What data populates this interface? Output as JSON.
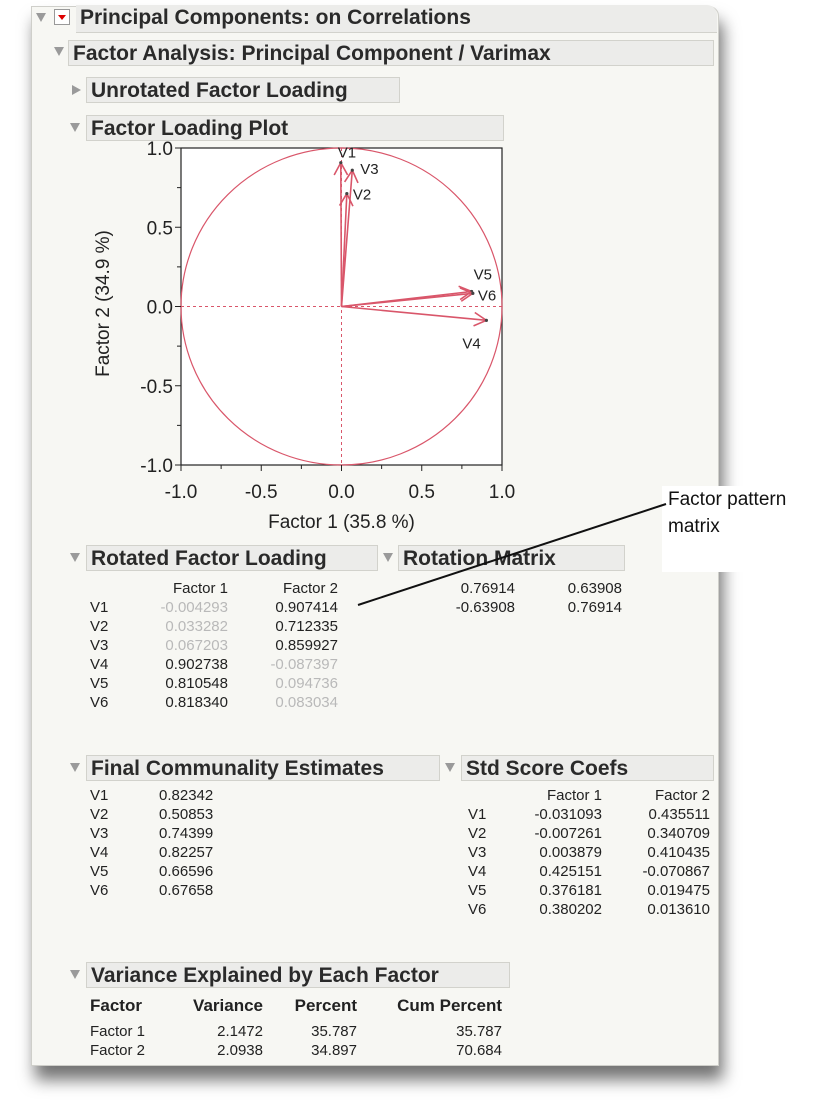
{
  "outline": {
    "root_title": "Principal Components: on Correlations",
    "factor_analysis_title": "Factor Analysis: Principal Component / Varimax",
    "unrotated_title": "Unrotated Factor Loading",
    "plot_title": "Factor Loading Plot"
  },
  "chart_data": {
    "type": "scatter",
    "title": "Factor Loading Plot",
    "xlabel": "Factor 1  (35.8 %)",
    "ylabel": "Factor 2  (34.9 %)",
    "xlim": [
      -1.0,
      1.0
    ],
    "ylim": [
      -1.0,
      1.0
    ],
    "xticks": [
      "-1.0",
      "-0.5",
      "0.0",
      "0.5",
      "1.0"
    ],
    "yticks": [
      "1.0",
      "0.5",
      "0.0",
      "-0.5",
      "-1.0"
    ],
    "xtick_values": [
      -1.0,
      -0.5,
      0.0,
      0.5,
      1.0
    ],
    "ytick_values": [
      1.0,
      0.5,
      0.0,
      -0.5,
      -1.0
    ],
    "unit_circle": true,
    "grid": false,
    "series_color": "#d9566a",
    "points": [
      {
        "label": "V1",
        "x": -0.004293,
        "y": 0.907414
      },
      {
        "label": "V2",
        "x": 0.033282,
        "y": 0.712335
      },
      {
        "label": "V3",
        "x": 0.067203,
        "y": 0.859927
      },
      {
        "label": "V4",
        "x": 0.902738,
        "y": -0.087397
      },
      {
        "label": "V5",
        "x": 0.810548,
        "y": 0.094736
      },
      {
        "label": "V6",
        "x": 0.81834,
        "y": 0.083034
      }
    ]
  },
  "rotated": {
    "title": "Rotated Factor Loading",
    "headers": [
      "Factor 1",
      "Factor 2"
    ],
    "rows": [
      {
        "name": "V1",
        "f1": "-0.004293",
        "f2": "0.907414",
        "dim1": true,
        "dim2": false
      },
      {
        "name": "V2",
        "f1": "0.033282",
        "f2": "0.712335",
        "dim1": true,
        "dim2": false
      },
      {
        "name": "V3",
        "f1": "0.067203",
        "f2": "0.859927",
        "dim1": true,
        "dim2": false
      },
      {
        "name": "V4",
        "f1": "0.902738",
        "f2": "-0.087397",
        "dim1": false,
        "dim2": true
      },
      {
        "name": "V5",
        "f1": "0.810548",
        "f2": "0.094736",
        "dim1": false,
        "dim2": true
      },
      {
        "name": "V6",
        "f1": "0.818340",
        "f2": "0.083034",
        "dim1": false,
        "dim2": true
      }
    ]
  },
  "rotation": {
    "title": "Rotation Matrix",
    "rows": [
      [
        "0.76914",
        "0.63908"
      ],
      [
        "-0.63908",
        "0.76914"
      ]
    ]
  },
  "communality": {
    "title": "Final Communality Estimates",
    "rows": [
      {
        "name": "V1",
        "value": "0.82342"
      },
      {
        "name": "V2",
        "value": "0.50853"
      },
      {
        "name": "V3",
        "value": "0.74399"
      },
      {
        "name": "V4",
        "value": "0.82257"
      },
      {
        "name": "V5",
        "value": "0.66596"
      },
      {
        "name": "V6",
        "value": "0.67658"
      }
    ]
  },
  "stdscore": {
    "title": "Std Score Coefs",
    "headers": [
      "Factor 1",
      "Factor 2"
    ],
    "rows": [
      {
        "name": "V1",
        "f1": "-0.031093",
        "f2": "0.435511"
      },
      {
        "name": "V2",
        "f1": "-0.007261",
        "f2": "0.340709"
      },
      {
        "name": "V3",
        "f1": "0.003879",
        "f2": "0.410435"
      },
      {
        "name": "V4",
        "f1": "0.425151",
        "f2": "-0.070867"
      },
      {
        "name": "V5",
        "f1": "0.376181",
        "f2": "0.019475"
      },
      {
        "name": "V6",
        "f1": "0.380202",
        "f2": "0.013610"
      }
    ]
  },
  "variance": {
    "title": "Variance Explained by Each Factor",
    "headers": [
      "Factor",
      "Variance",
      "Percent",
      "Cum Percent"
    ],
    "rows": [
      [
        "Factor 1",
        "2.1472",
        "35.787",
        "35.787"
      ],
      [
        "Factor 2",
        "2.0938",
        "34.897",
        "70.684"
      ]
    ]
  },
  "callout": {
    "line1": "Factor pattern",
    "line2": "matrix"
  }
}
